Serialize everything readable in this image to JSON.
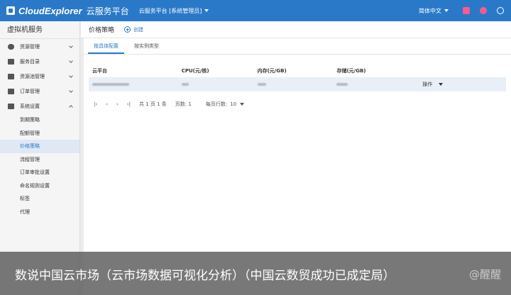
{
  "topbar": {
    "logo": "CloudExplorer",
    "product": "云服务平台",
    "tenant": "云服务平台 [系统管理员]",
    "lang": "简体中文"
  },
  "sidebar": {
    "title": "虚拟机服务",
    "menus": [
      {
        "label": "资源管理",
        "icon": "cloud-icon"
      },
      {
        "label": "服务目录",
        "icon": "grid-icon"
      },
      {
        "label": "资源池管理",
        "icon": "server-icon"
      },
      {
        "label": "订单管理",
        "icon": "list-icon"
      },
      {
        "label": "系统设置",
        "icon": "wrench-icon"
      }
    ],
    "subitems": [
      "到期策略",
      "配额管理",
      "价格策略",
      "流程管理",
      "订单审批设置",
      "命名规则设置",
      "标签",
      "代理"
    ]
  },
  "main": {
    "title": "价格策略",
    "create": "创建",
    "tabs": [
      "按具体配置",
      "按实例类型"
    ],
    "columns": [
      "云平台",
      "CPU(元/核)",
      "内存(元/GB)",
      "存储(元/GB)"
    ],
    "row_action": "操作",
    "pager": {
      "total": "共 1 页 1 条",
      "page": "页数: 1",
      "per_page_label": "每页行数:",
      "per_page": "10"
    }
  },
  "overlay": {
    "caption": "数说中国云市场（云市场数据可视化分析）（中国云数贸成功已成定局）",
    "watermark": "@醒醒"
  },
  "colors": {
    "brand": "#2a79c9",
    "accent": "#ff5a8a"
  }
}
